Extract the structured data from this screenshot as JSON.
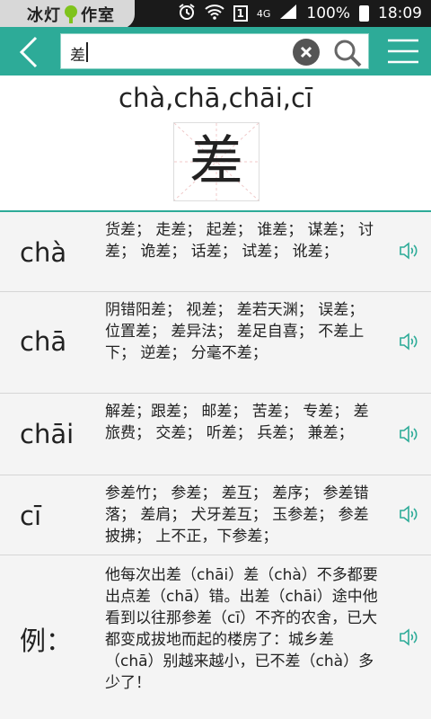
{
  "status_bar": {
    "brand_left": "冰灯",
    "brand_right": "作室",
    "sim": "1",
    "network": "4G",
    "battery": "100%",
    "time": "18:09"
  },
  "search": {
    "value": "差"
  },
  "hero": {
    "pinyin_all": "chà,chā,chāi,cī",
    "character": "差"
  },
  "readings": [
    {
      "pinyin": "chà",
      "words": "货差； 走差； 起差； 谁差； 谋差； 讨差； 诡差； 话差； 试差； 讹差；"
    },
    {
      "pinyin": "chā",
      "words": "阴错阳差； 视差； 差若天渊； 误差； 位置差； 差异法； 差足自喜； 不差上下； 逆差； 分毫不差；"
    },
    {
      "pinyin": "chāi",
      "words": "解差；跟差； 邮差； 苦差； 专差； 差旅费； 交差； 听差； 兵差； 兼差；"
    },
    {
      "pinyin": "cī",
      "words": "参差竹； 参差； 差互； 差序； 参差错落； 差肩； 犬牙差互； 玉参差； 参差披拂； 上不正，下参差；"
    }
  ],
  "example": {
    "label": "例：",
    "text": "他每次出差（chāi）差（chà）不多都要出点差（chā）错。出差（chāi）途中他看到以往那参差（cī）不齐的农舍，已大都变成拔地而起的楼房了：城乡差（chā）别越来越小，已不差（chà）多少了！"
  },
  "colors": {
    "accent": "#2dab98",
    "status_bar": "#1a1a1a",
    "background": "#f4f4f4"
  },
  "icons": [
    "back-arrow-icon",
    "clear-icon",
    "search-icon",
    "menu-icon",
    "speaker-icon",
    "alarm-icon",
    "wifi-icon",
    "signal-icon",
    "battery-icon"
  ]
}
